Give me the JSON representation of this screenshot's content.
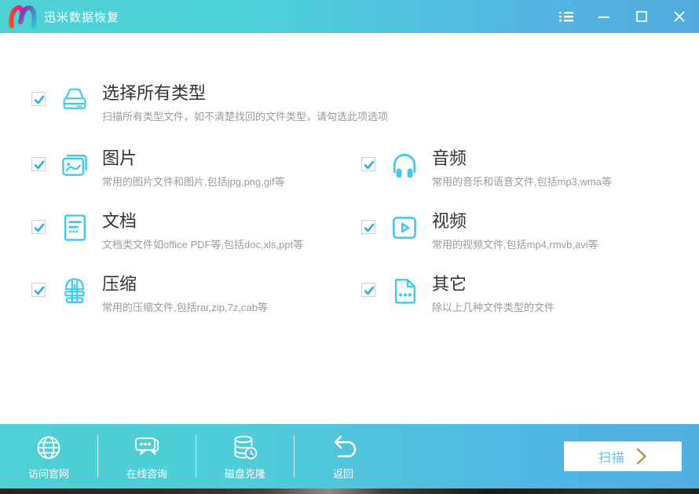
{
  "window": {
    "title": "迅米数据恢复",
    "controls": {
      "menu": "menu-list-icon",
      "minimize": "minimize-icon",
      "maximize": "maximize-icon",
      "close": "close-icon"
    }
  },
  "file_types": {
    "select_all": {
      "label": "选择所有类型",
      "desc": "扫描所有类型文件，如不清楚找回的文件类型，请勾选此项选项",
      "checked": true,
      "icon": "drive-icon"
    },
    "items": [
      {
        "label": "图片",
        "desc": "常用的图片文件和图片,包括jpg,png,gif等",
        "checked": true,
        "icon": "image-icon"
      },
      {
        "label": "音频",
        "desc": "常用的音乐和语音文件,包括mp3,wma等",
        "checked": true,
        "icon": "headphones-icon"
      },
      {
        "label": "文档",
        "desc": "文档类文件如office PDF等,包括doc,xls,ppt等",
        "checked": true,
        "icon": "document-icon"
      },
      {
        "label": "视频",
        "desc": "常用的视频文件,包括mp4,rmvb,avi等",
        "checked": true,
        "icon": "video-play-icon"
      },
      {
        "label": "压缩",
        "desc": "常用的压缩文件,包括rar,zip,7z,cab等",
        "checked": true,
        "icon": "archive-icon"
      },
      {
        "label": "其它",
        "desc": "除以上几种文件类型的文件",
        "checked": true,
        "icon": "file-dots-icon"
      }
    ]
  },
  "footer": {
    "actions": [
      {
        "label": "访问官网",
        "icon": "globe-icon"
      },
      {
        "label": "在线咨询",
        "icon": "chat-icon"
      },
      {
        "label": "磁盘克隆",
        "icon": "disk-clone-icon"
      },
      {
        "label": "返回",
        "icon": "back-arrow-icon"
      }
    ],
    "scan_label": "扫描"
  },
  "colors": {
    "titlebar_left": "#4fd1d4",
    "titlebar_right": "#53aadf",
    "accent_cyan": "#41c8ee",
    "check_blue": "#29b2e8",
    "title_text": "#333333",
    "desc_text": "#9b9b9b",
    "scan_text": "#56c5ef",
    "scan_chevron_gold": "#a39b52"
  }
}
